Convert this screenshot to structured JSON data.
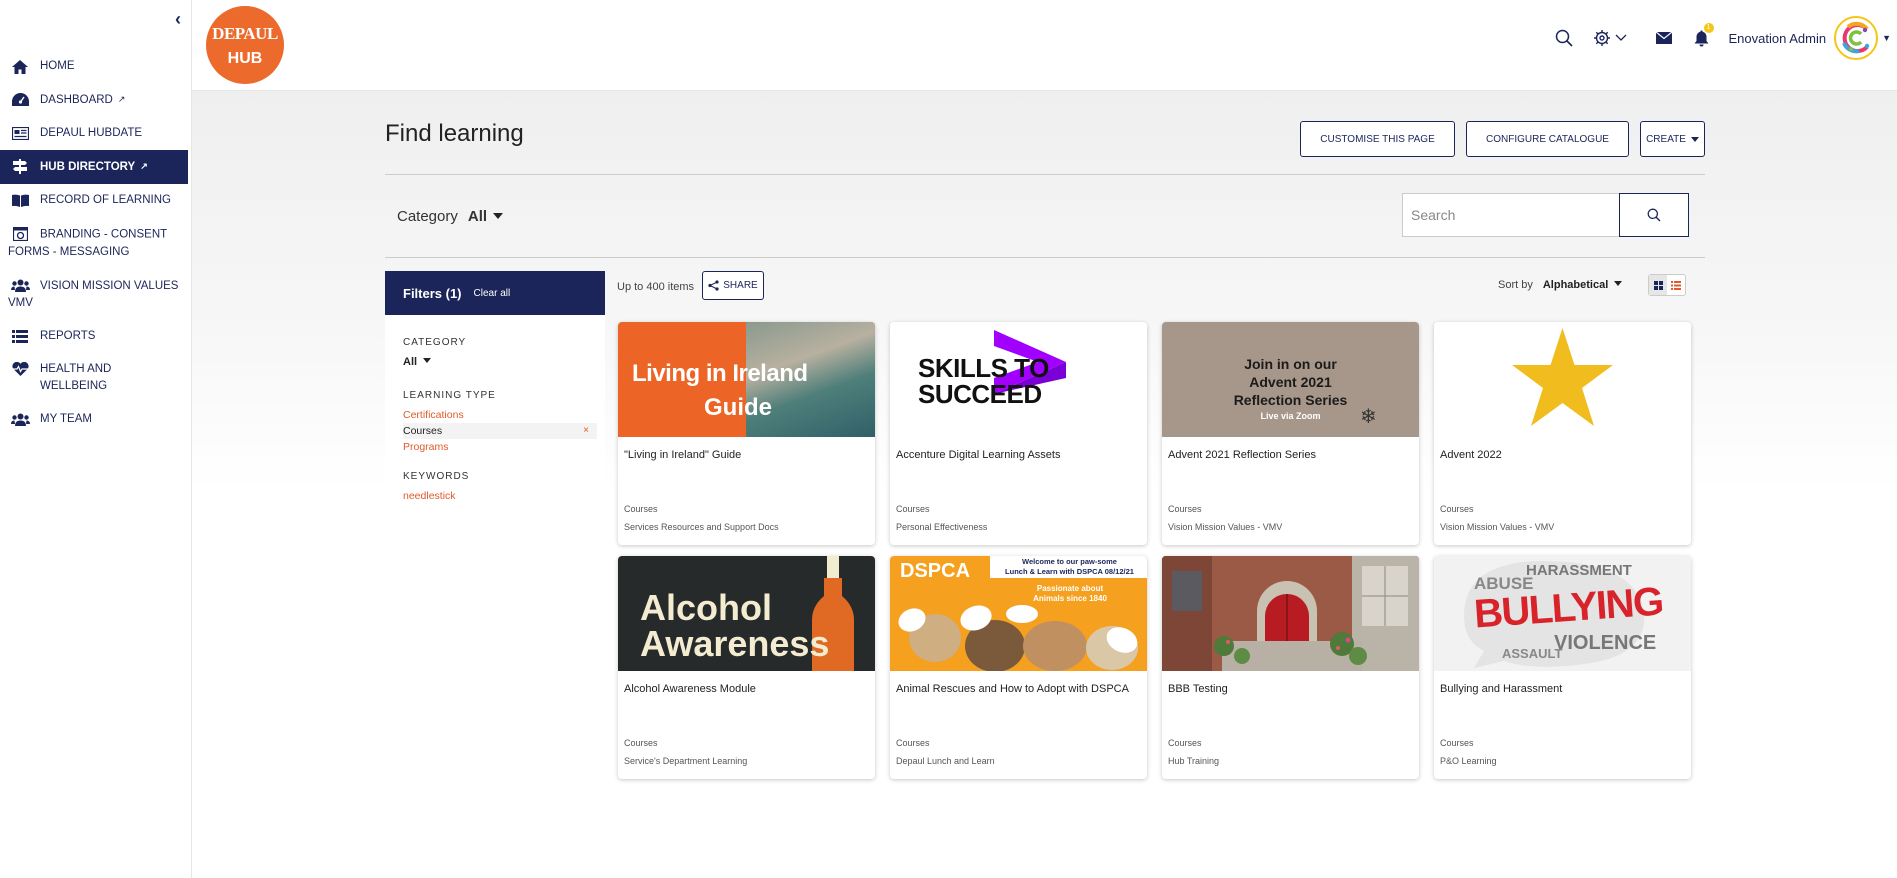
{
  "sidebar": {
    "items": [
      {
        "label": "HOME"
      },
      {
        "label": "DASHBOARD"
      },
      {
        "label": "DEPAUL HUBDATE"
      },
      {
        "label": "HUB DIRECTORY"
      },
      {
        "label": "RECORD OF LEARNING"
      },
      {
        "label": "BRANDING - CONSENT FORMS - MESSAGING"
      },
      {
        "label": "VISION MISSION VALUES VMV"
      },
      {
        "label": "REPORTS"
      },
      {
        "label": "HEALTH AND WELLBEING"
      },
      {
        "label": "MY TEAM"
      }
    ]
  },
  "header": {
    "logo_line1": "DEPAUL",
    "logo_line2": "HUB",
    "user_name": "Enovation Admin",
    "notification_count": "1"
  },
  "page": {
    "title": "Find learning",
    "buttons": {
      "customise": "CUSTOMISE THIS PAGE",
      "configure": "CONFIGURE CATALOGUE",
      "create": "CREATE"
    },
    "category_label": "Category",
    "category_value": "All",
    "search_placeholder": "Search"
  },
  "filters": {
    "title": "Filters (1)",
    "clear": "Clear all",
    "category_heading": "CATEGORY",
    "category_value": "All",
    "learning_type_heading": "LEARNING TYPE",
    "learning_types": [
      "Certifications",
      "Courses",
      "Programs"
    ],
    "selected_remove": "×",
    "keywords_heading": "KEYWORDS",
    "keyword": "needlestick"
  },
  "results": {
    "count": "Up to 400 items",
    "share": "SHARE",
    "sort_label": "Sort by",
    "sort_value": "Alphabetical"
  },
  "cards": [
    {
      "title": "\"Living in Ireland\" Guide",
      "type": "Courses",
      "category": "Services Resources and Support Docs",
      "thumb_text1": "Living in Ireland",
      "thumb_text2": "Guide"
    },
    {
      "title": "Accenture Digital Learning Assets",
      "type": "Courses",
      "category": "Personal Effectiveness",
      "thumb_text1": "SKILLS TO",
      "thumb_text2": "SUCCEED"
    },
    {
      "title": "Advent 2021 Reflection Series",
      "type": "Courses",
      "category": "Vision Mission Values - VMV",
      "thumb_text1": "Join in on our",
      "thumb_text2": "Advent 2021",
      "thumb_text3": "Reflection Series",
      "thumb_text4": "Live via Zoom"
    },
    {
      "title": "Advent 2022",
      "type": "Courses",
      "category": "Vision Mission Values - VMV"
    },
    {
      "title": "Alcohol Awareness Module",
      "type": "Courses",
      "category": "Service's Department Learning",
      "thumb_text1": "Alcohol",
      "thumb_text2": "Awareness"
    },
    {
      "title": "Animal Rescues and How to Adopt with DSPCA",
      "type": "Courses",
      "category": "Depaul Lunch and Learn",
      "thumb_text1": "Welcome to our paw-some",
      "thumb_text2": "Lunch & Learn with DSPCA 08/12/21",
      "thumb_text3": "DSPCA",
      "thumb_text4": "Passionate about",
      "thumb_text5": "Animals since 1840"
    },
    {
      "title": "BBB Testing",
      "type": "Courses",
      "category": "Hub Training"
    },
    {
      "title": "Bullying and Harassment",
      "type": "Courses",
      "category": "P&O Learning",
      "thumb_text1": "HARASSMENT",
      "thumb_text2": "ABUSE",
      "thumb_text3": "BULLYING",
      "thumb_text4": "VIOLENCE",
      "thumb_text5": "ASSAULT"
    }
  ],
  "colors": {
    "navy": "#1b2559",
    "orange": "#e05a2b",
    "logo": "#ec6a2c"
  }
}
